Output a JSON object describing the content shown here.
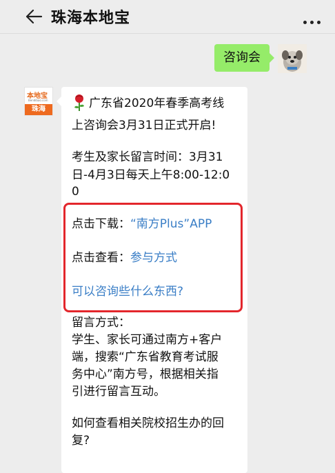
{
  "header": {
    "title": "珠海本地宝"
  },
  "out_msg": {
    "text": "咨询会"
  },
  "bot_avatar": {
    "brand": "本地宝",
    "sub": "Bendibao.com",
    "city": "珠海"
  },
  "message": {
    "line1": "广东省2020年春季高考线",
    "line2": "上咨询会3月31日正式开启!",
    "line3": "考生及家长留言时间：3月31",
    "line4": "日-4月3日每天上午8:00-12:0",
    "line5": "0",
    "download_label": "点击下载：",
    "download_link": "“南方Plus”APP",
    "view_label": "点击查看：",
    "view_link": "参与方式",
    "consult_link": "可以咨询些什么东西?",
    "method_title": "留言方式：",
    "method1": "学生、家长可通过南方+客户",
    "method2": "端，搜索“广东省教育考试服",
    "method3": "务中心”南方号，根据相关指",
    "method4": "引进行留言互动。",
    "q1": "如何查看相关院校招生办的回",
    "q2": "复?"
  },
  "colors": {
    "accent_green": "#95ec69",
    "link_blue": "#3a7ec6",
    "highlight_red": "#e3262c",
    "brand_orange": "#ee6a1f"
  }
}
